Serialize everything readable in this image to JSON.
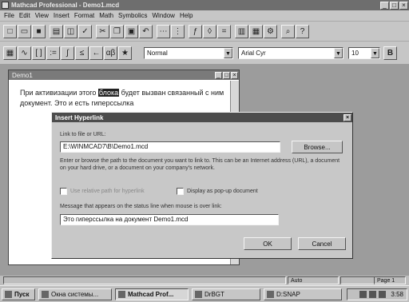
{
  "app": {
    "title": "Mathcad Professional - Demo1.mcd"
  },
  "menu": [
    "File",
    "Edit",
    "View",
    "Insert",
    "Format",
    "Math",
    "Symbolics",
    "Window",
    "Help"
  ],
  "toolbar": {
    "style_value": "Normal",
    "font_value": "Arial Cyr",
    "size_value": "10"
  },
  "document": {
    "title": "Demo1",
    "text_before": "При активизации этого",
    "text_selected": "блока",
    "text_after": "будет вызван связанный с ним документ. Это и есть гиперссылка"
  },
  "dialog": {
    "title": "Insert Hyperlink",
    "link_label": "Link to file or URL:",
    "link_value": "E:\\WINMCAD7\\B\\Demo1.mcd",
    "browse_label": "Browse...",
    "help_text": "Enter or browse the path to the document you want to link to. This can be an Internet address (URL), a document on your hard drive, or a document on your company's network.",
    "relative_label": "Use relative path for hyperlink",
    "popup_label": "Display as pop-up document",
    "message_label": "Message that appears on the status line when mouse is over link:",
    "message_value": "Это гиперссылка на документ Demo1.mcd",
    "ok_label": "OK",
    "cancel_label": "Cancel"
  },
  "statusbar": {
    "mode": "Auto",
    "page": "Page 1"
  },
  "taskbar": {
    "items": [
      "Пуск",
      "Окна системы...",
      "Mathcad Prof...",
      "DrBGT",
      "D:SNAP"
    ],
    "clock": "3:58"
  }
}
